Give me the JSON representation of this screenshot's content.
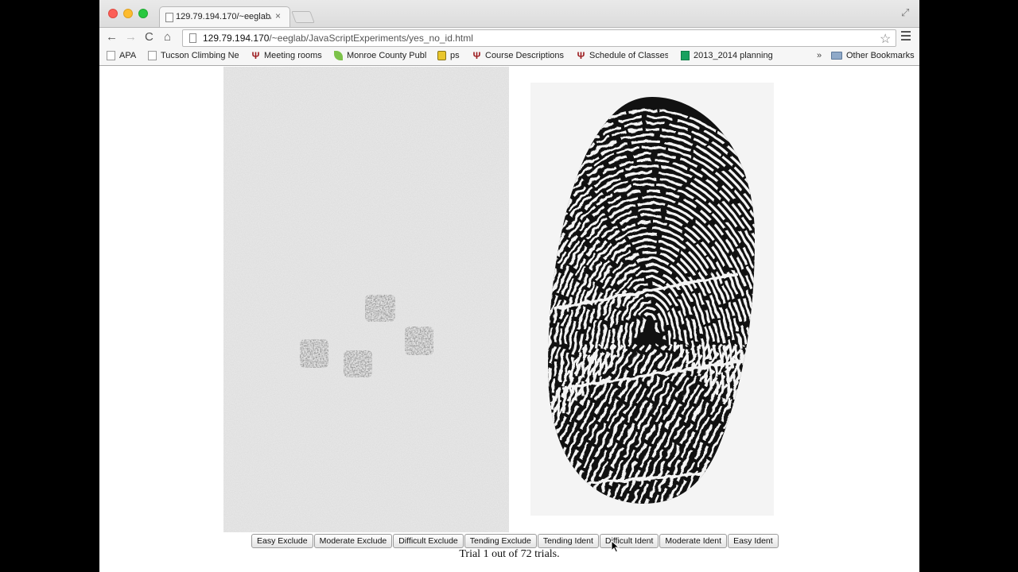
{
  "browser": {
    "tab_title": "129.79.194.170/~eeglab/",
    "tab_close": "×",
    "url_host": "129.79.194.170",
    "url_path": "/~eeglab/JavaScriptExperiments/yes_no_id.html",
    "nav_back": "←",
    "nav_forward": "→",
    "nav_reload": "C",
    "nav_home": "⌂",
    "star": "☆",
    "fullscreen": "⤢"
  },
  "bookmarks": {
    "items": [
      {
        "label": "APA",
        "icon": "page-icon"
      },
      {
        "label": "Tucson Climbing Ne",
        "icon": "page-icon"
      },
      {
        "label": "Meeting rooms",
        "icon": "iu-icon"
      },
      {
        "label": "Monroe County Publ",
        "icon": "leaf-icon"
      },
      {
        "label": "ps",
        "icon": "bag-icon"
      },
      {
        "label": "Course Descriptions",
        "icon": "iu-icon"
      },
      {
        "label": "Schedule of Classes",
        "icon": "iu-icon"
      },
      {
        "label": "2013_2014 planning",
        "icon": "spreadsheet-icon"
      }
    ],
    "overflow": "»",
    "other": "Other Bookmarks"
  },
  "experiment": {
    "buttons": [
      "Easy Exclude",
      "Moderate Exclude",
      "Difficult Exclude",
      "Tending Exclude",
      "Tending Ident",
      "Difficult Ident",
      "Moderate Ident",
      "Easy Ident"
    ],
    "trial_status": "Trial 1 out of 72 trials."
  },
  "colors": {
    "latent_background": "#ebebeb",
    "print_ink": "#111111"
  }
}
